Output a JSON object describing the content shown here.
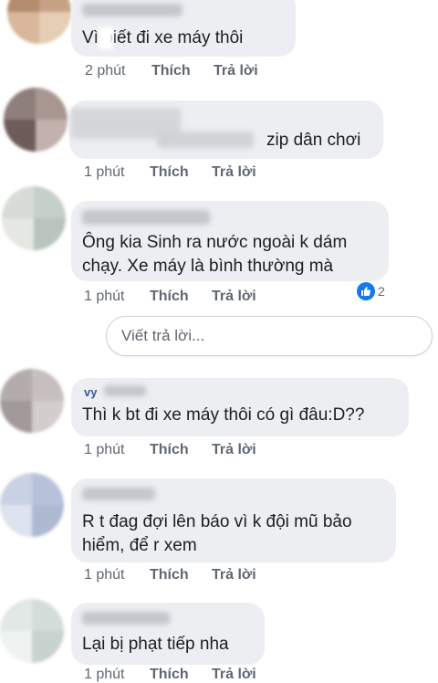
{
  "comments": [
    {
      "name": "",
      "text": "Vì   biết đi xe máy thôi",
      "time": "2 phút",
      "like": "Thích",
      "reply": "Trả lời"
    },
    {
      "name": "",
      "text": "zip dân chơi",
      "time": "1 phút",
      "like": "Thích",
      "reply": "Trả lời"
    },
    {
      "name": "",
      "text_line1": "Ông kia Sinh ra nước ngoài k dám",
      "text_line2": "chạy. Xe máy là bình thường mà",
      "time": "1 phút",
      "like": "Thích",
      "reply": "Trả lời",
      "reaction_count": "2"
    },
    {
      "name": "vy",
      "text": "Thì k bt đi xe máy thôi có gì đâu:D??",
      "time": "1 phút",
      "like": "Thích",
      "reply": "Trả lời"
    },
    {
      "name": "",
      "text_line1": "R t đag đợi lên báo vì k đội mũ bảo",
      "text_line2": "hiểm, để r xem",
      "time": "1 phút",
      "like": "Thích",
      "reply": "Trả lời"
    },
    {
      "name": "",
      "text": "Lại bị phạt tiếp nha",
      "time": "1 phút",
      "like": "Thích",
      "reply": "Trả lời"
    }
  ],
  "reply_box": {
    "placeholder": "Viết trả lời..."
  },
  "colors": {
    "like_blue": "#1877f2",
    "bubble_bg": "#eceef2",
    "meta_text": "#606770"
  },
  "icons": {
    "reaction": "like-thumb-icon"
  }
}
